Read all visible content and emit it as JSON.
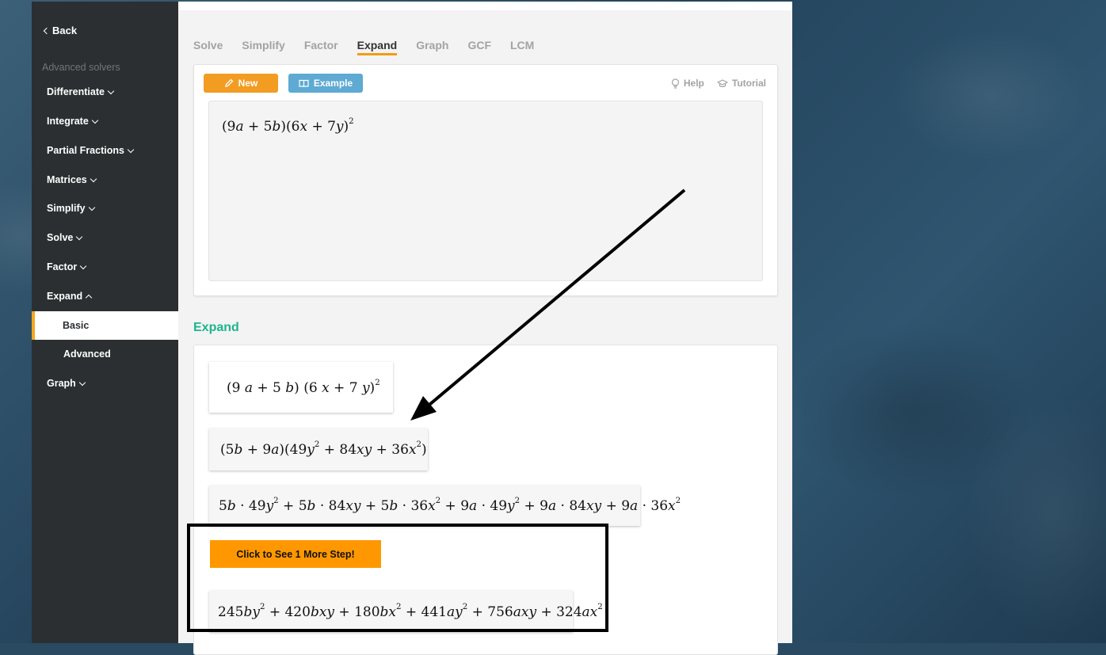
{
  "sidebar": {
    "back_label": "Back",
    "section_title": "Advanced solvers",
    "items": [
      {
        "label": "Differentiate"
      },
      {
        "label": "Integrate"
      },
      {
        "label": "Partial Fractions"
      },
      {
        "label": "Matrices"
      },
      {
        "label": "Simplify"
      },
      {
        "label": "Solve"
      },
      {
        "label": "Factor"
      },
      {
        "label": "Expand"
      },
      {
        "label": "Graph"
      }
    ],
    "expand_sub": {
      "active": "Basic",
      "other": "Advanced"
    }
  },
  "tabs": [
    {
      "label": "Solve"
    },
    {
      "label": "Simplify"
    },
    {
      "label": "Factor"
    },
    {
      "label": "Expand",
      "active": true
    },
    {
      "label": "Graph"
    },
    {
      "label": "GCF"
    },
    {
      "label": "LCM"
    }
  ],
  "toolbar": {
    "new_label": "New",
    "example_label": "Example",
    "help_label": "Help",
    "tutorial_label": "Tutorial"
  },
  "input": {
    "expression": "(9a+5b)(6x+7y)^2"
  },
  "result": {
    "title": "Expand",
    "steps": [
      "(9 a+5 b) (6 x+7 y)^2",
      "(5b+9a)(49y^2+84xy+36x^2)",
      "5b·49y^2+5b·84xy+5b·36x^2+9a·49y^2+9a·84xy+9a·36x^2",
      "245by^2+420bxy+180bx^2+441ay^2+756axy+324ax^2"
    ],
    "more_steps_label": "Click to See 1 More Step!"
  },
  "colors": {
    "accent_orange": "#f39c22",
    "accent_blue": "#5eaad3",
    "expand_green": "#1db58f",
    "sidebar_bg": "#2b2f31"
  },
  "icons": [
    "chevron-left-icon",
    "chevron-down-icon",
    "chevron-up-icon",
    "pencil-icon",
    "book-icon",
    "lightbulb-icon",
    "graduation-cap-icon"
  ]
}
